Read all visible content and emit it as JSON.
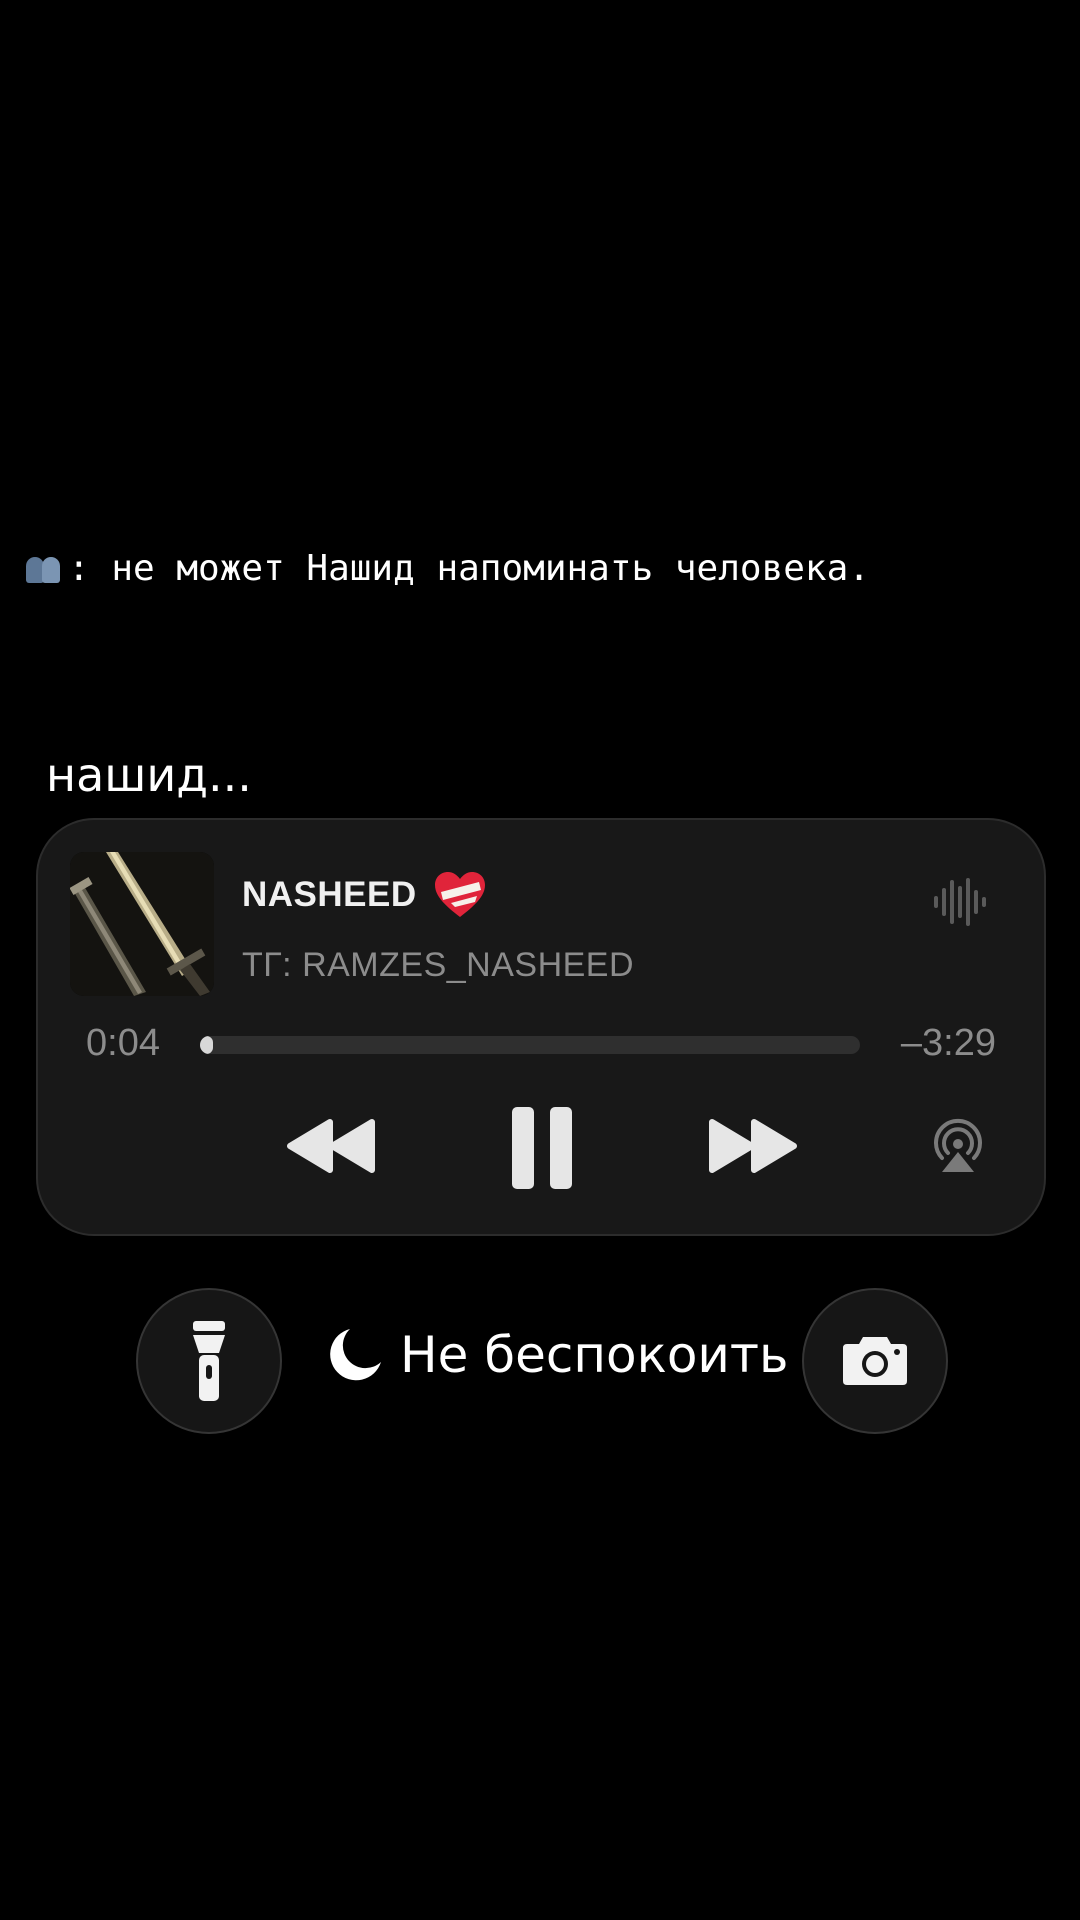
{
  "caption": {
    "emoji": "people-emoji-icon",
    "text": ": не может Нашид напоминать человека."
  },
  "subtitle": "нашид...",
  "player": {
    "title": "NASHEED",
    "title_emoji": "mending-heart-icon",
    "artist": "ТГ: RAMZES_NASHEED",
    "time_current": "0:04",
    "time_remaining": "–3:29",
    "progress_fraction": 0.019,
    "controls": [
      "rewind-icon",
      "pause-icon",
      "fast-forward-icon",
      "airplay-icon"
    ],
    "waveform_icon": "waveform-icon"
  },
  "quick_actions": {
    "flashlight_icon": "flashlight-icon",
    "dnd_icon": "moon-icon",
    "dnd_label": "Не беспокоить",
    "camera_icon": "camera-icon"
  },
  "colors": {
    "background": "#000000",
    "card": "#181818",
    "secondary_text": "#8c8c8c",
    "heart": "#e0243a"
  }
}
